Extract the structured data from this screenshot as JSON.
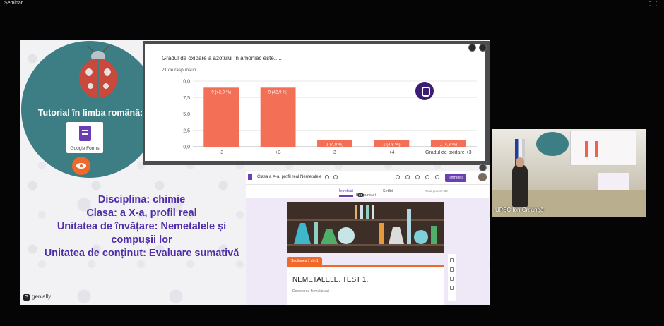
{
  "window": {
    "title": "Seminar",
    "options_icon": "more-options-icon"
  },
  "slide": {
    "tutorial_title": "Tutorial în limba română:",
    "gforms_label": "Google Forms",
    "lines": [
      "Disciplina: chimie",
      "Clasa: a X-a, profil real",
      "Unitatea de învățare:  Nemetalele și compușii lor",
      "Unitatea de conținut:  Evaluare sumativă"
    ],
    "brand": "genially"
  },
  "chart_card": {
    "question": "Gradul de oxidare a azotului în amoniac este.....",
    "responses": "21 de răspunsuri"
  },
  "chart_data": {
    "type": "bar",
    "title": "Gradul de oxidare a azotului în amoniac este.....",
    "subtitle": "21 de răspunsuri",
    "categories": [
      "-3",
      "+3",
      "3",
      "+4",
      "Gradul de oxidare +3"
    ],
    "values": [
      9,
      9,
      1,
      1,
      1
    ],
    "data_labels": [
      "9 (42,9 %)",
      "9 (42,9 %)",
      "1 (4,8 %)",
      "1 (4,8 %)",
      "1 (4,8 %)"
    ],
    "yticks": [
      "0,0",
      "2,5",
      "5,0",
      "7,5",
      "10,0"
    ],
    "ylim": [
      0,
      10
    ],
    "grid": true,
    "color": "#f36f56"
  },
  "form": {
    "title": "Clasa a X-a, profil real Nemetalele",
    "send_label": "Trimiteți",
    "tabs": [
      "Întrebări",
      "Răspunsuri",
      "Setări"
    ],
    "responses_badge": "21",
    "total_points": "Total puncte: 30",
    "section_label": "Secțiunea 1 din 1",
    "test_title": "NEMETALELE. TEST 1.",
    "test_description": "Descrierea formularului"
  },
  "webcam": {
    "name": "UPSC Ion Creangă"
  }
}
